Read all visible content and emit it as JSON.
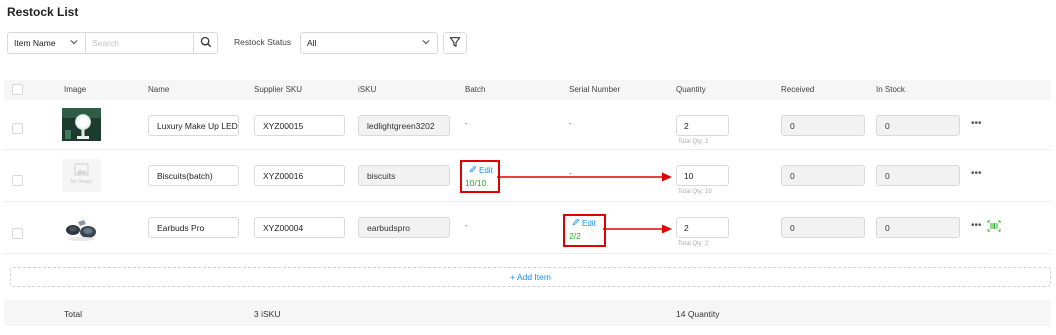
{
  "page": {
    "title": "Restock List"
  },
  "filters": {
    "field_select": "Item Name",
    "search_placeholder": "Search",
    "status_label": "Restock Status",
    "status_value": "All"
  },
  "table": {
    "headers": {
      "image": "Image",
      "name": "Name",
      "supplier_sku": "Supplier SKU",
      "isku": "iSKU",
      "batch": "Batch",
      "serial": "Serial Number",
      "quantity": "Quantity",
      "received": "Received",
      "in_stock": "In Stock"
    },
    "rows": [
      {
        "name": "Luxury Make Up LED Light",
        "supplier_sku": "XYZ00015",
        "isku": "ledlightgreen3202",
        "batch": "-",
        "serial": "-",
        "quantity": "2",
        "total_qty": "Total Qty: 2",
        "received": "0",
        "in_stock": "0"
      },
      {
        "no_image": "No Image",
        "name": "Biscuits(batch)",
        "supplier_sku": "XYZ00016",
        "isku": "biscuits",
        "batch_edit": "Edit",
        "batch_count": "10/10",
        "serial": "-",
        "quantity": "10",
        "total_qty": "Total Qty: 10",
        "received": "0",
        "in_stock": "0"
      },
      {
        "name": "Earbuds Pro",
        "supplier_sku": "XYZ00004",
        "isku": "earbudspro",
        "batch": "-",
        "serial_edit": "Edit",
        "serial_count": "2/2",
        "quantity": "2",
        "total_qty": "Total Qty: 2",
        "received": "0",
        "in_stock": "0"
      }
    ],
    "more_label": "•••",
    "add_item": "+ Add Item",
    "footer": {
      "total": "Total",
      "isku": "3 iSKU",
      "quantity": "14 Quantity"
    }
  },
  "colors": {
    "link": "#1890ff",
    "success": "#27ae27",
    "annotation": "#e00000"
  },
  "icons": [
    "chevron-down-icon",
    "search-icon",
    "filter-icon",
    "edit-pencil-icon",
    "more-icon",
    "scan-icon",
    "placeholder-image-icon"
  ]
}
